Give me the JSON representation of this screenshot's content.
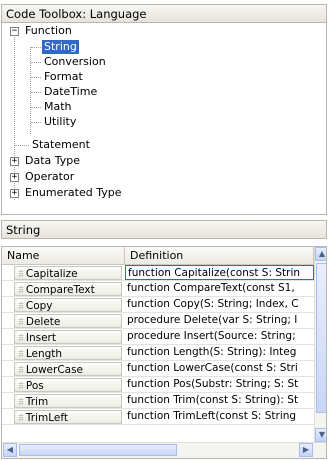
{
  "top_panel": {
    "title": "Code Toolbox: Language"
  },
  "tree": {
    "function": {
      "label": "Function",
      "expander": "−"
    },
    "function_children": [
      "String",
      "Conversion",
      "Format",
      "DateTime",
      "Math",
      "Utility"
    ],
    "selected": "String",
    "statement": {
      "label": "Statement"
    },
    "data_type": {
      "label": "Data Type",
      "expander": "+"
    },
    "operator": {
      "label": "Operator",
      "expander": "+"
    },
    "enumerated_type": {
      "label": "Enumerated Type",
      "expander": "+"
    }
  },
  "bottom_panel": {
    "title": "String"
  },
  "grid": {
    "columns": [
      "Name",
      "Definition"
    ],
    "rows": [
      {
        "name": "Capitalize",
        "definition": "function Capitalize(const S: Strin"
      },
      {
        "name": "CompareText",
        "definition": "function CompareText(const S1, "
      },
      {
        "name": "Copy",
        "definition": "function Copy(S: String; Index, C"
      },
      {
        "name": "Delete",
        "definition": "procedure Delete(var S: String; I"
      },
      {
        "name": "Insert",
        "definition": "procedure Insert(Source: String;"
      },
      {
        "name": "Length",
        "definition": "function Length(S: String): Integ"
      },
      {
        "name": "LowerCase",
        "definition": "function LowerCase(const S: Stri"
      },
      {
        "name": "Pos",
        "definition": "function Pos(Substr: String; S: St"
      },
      {
        "name": "Trim",
        "definition": "function Trim(const S: String): St"
      },
      {
        "name": "TrimLeft",
        "definition": "function TrimLeft(const S: String"
      }
    ]
  },
  "colors": {
    "selection": "#316ac5",
    "panel_border": "#b8b6ae",
    "scroll_accent": "#a9bfe8"
  },
  "icons": {
    "grip": "grip-dots-icon",
    "scroll_up": "arrow-up-icon",
    "scroll_down": "arrow-down-icon",
    "scroll_left": "arrow-left-icon",
    "scroll_right": "arrow-right-icon"
  }
}
